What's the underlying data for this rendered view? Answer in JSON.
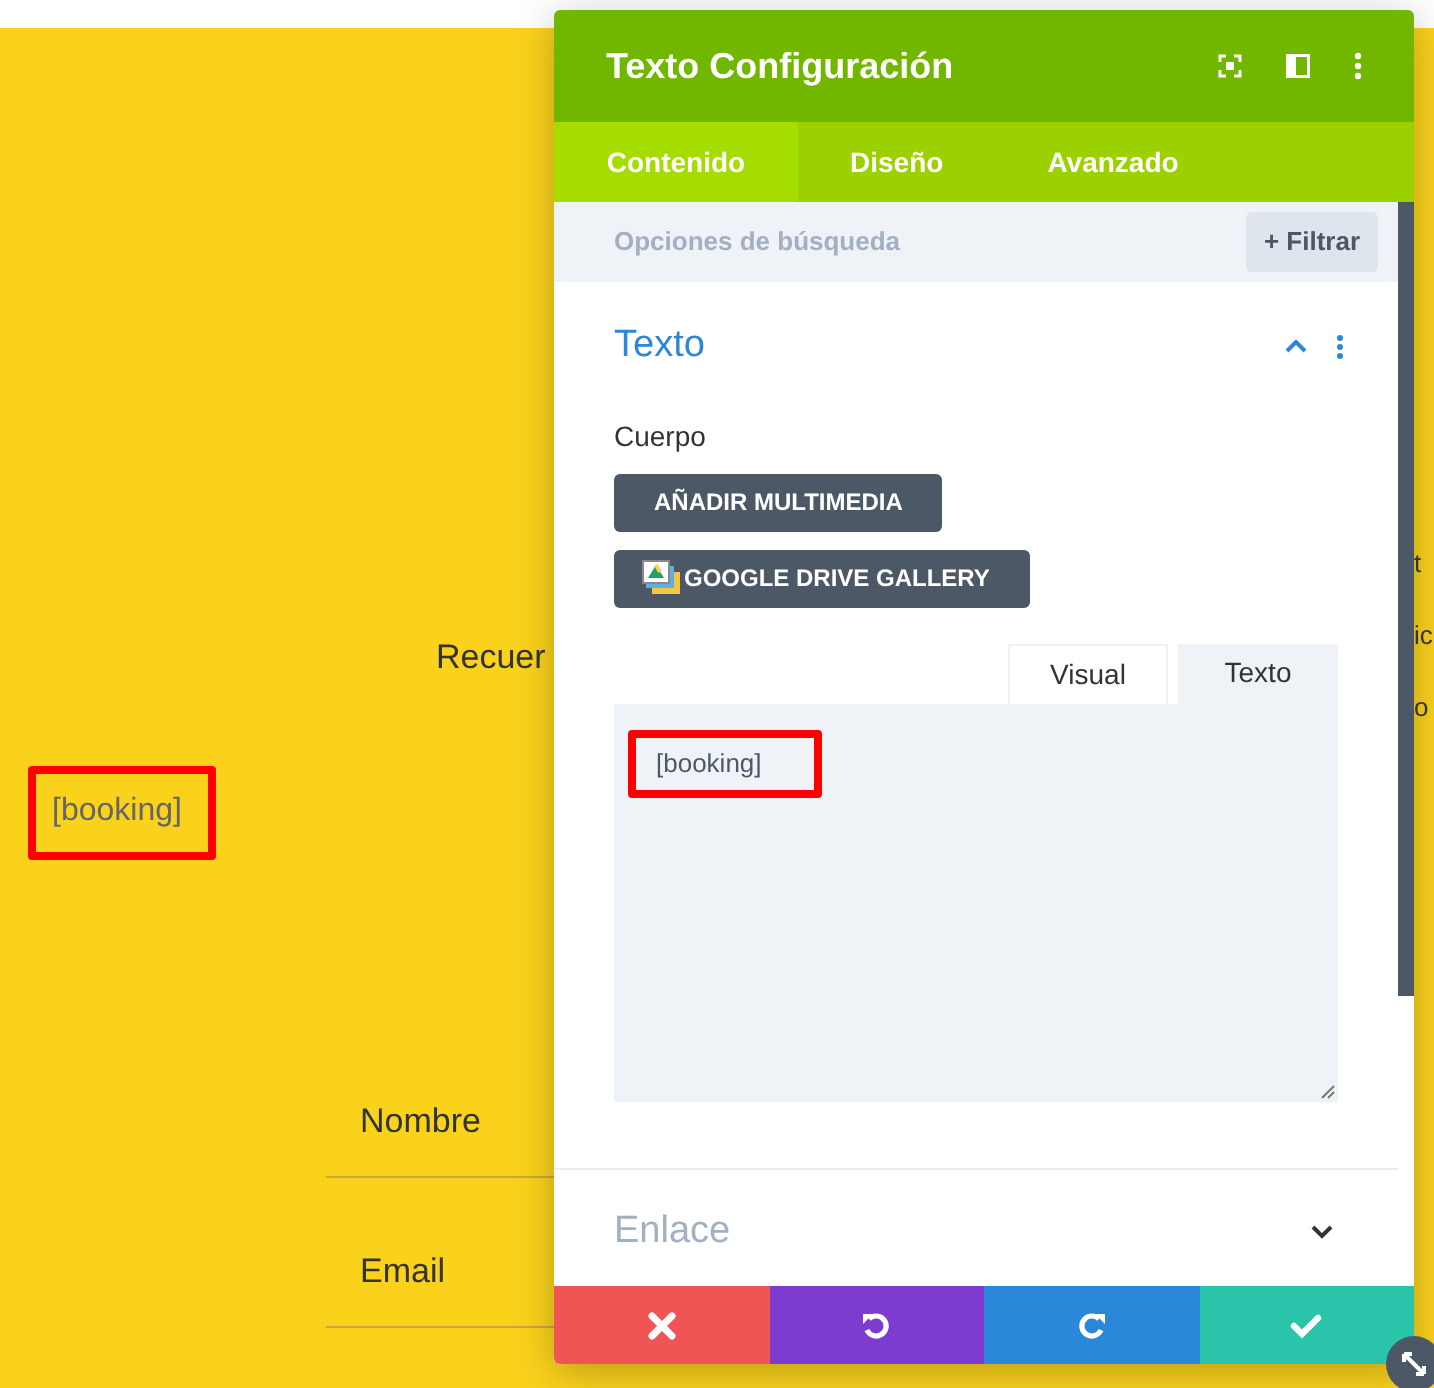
{
  "page": {
    "intro_text": "Recuer",
    "shortcode": {
      "text": "[booking]",
      "highlighted": true
    },
    "form_fields": [
      "Nombre",
      "Email"
    ],
    "edge_texts": [
      "t",
      "ic",
      "o"
    ]
  },
  "panel": {
    "title": "Texto Configuración",
    "tabs": [
      {
        "label": "Contenido",
        "selected": true
      },
      {
        "label": "Diseño",
        "selected": false
      },
      {
        "label": "Avanzado",
        "selected": false
      }
    ],
    "search": {
      "placeholder": "Opciones de búsqueda",
      "filter_button": "+ Filtrar"
    },
    "sections": [
      {
        "title": "Texto",
        "expanded": true,
        "field_label": "Cuerpo",
        "buttons": [
          {
            "label": "AÑADIR MULTIMEDIA",
            "kind": "plain"
          },
          {
            "label": "GOOGLE DRIVE GALLERY",
            "kind": "drive"
          }
        ],
        "editor_tabs": [
          {
            "label": "Visual",
            "selected": false
          },
          {
            "label": "Texto",
            "selected": true
          }
        ],
        "editor": {
          "value": "[booking]",
          "highlighted": true
        }
      },
      {
        "title": "Enlace",
        "expanded": false
      }
    ],
    "footer": [
      {
        "kind": "discard"
      },
      {
        "kind": "undo"
      },
      {
        "kind": "redo"
      },
      {
        "kind": "save"
      }
    ]
  }
}
